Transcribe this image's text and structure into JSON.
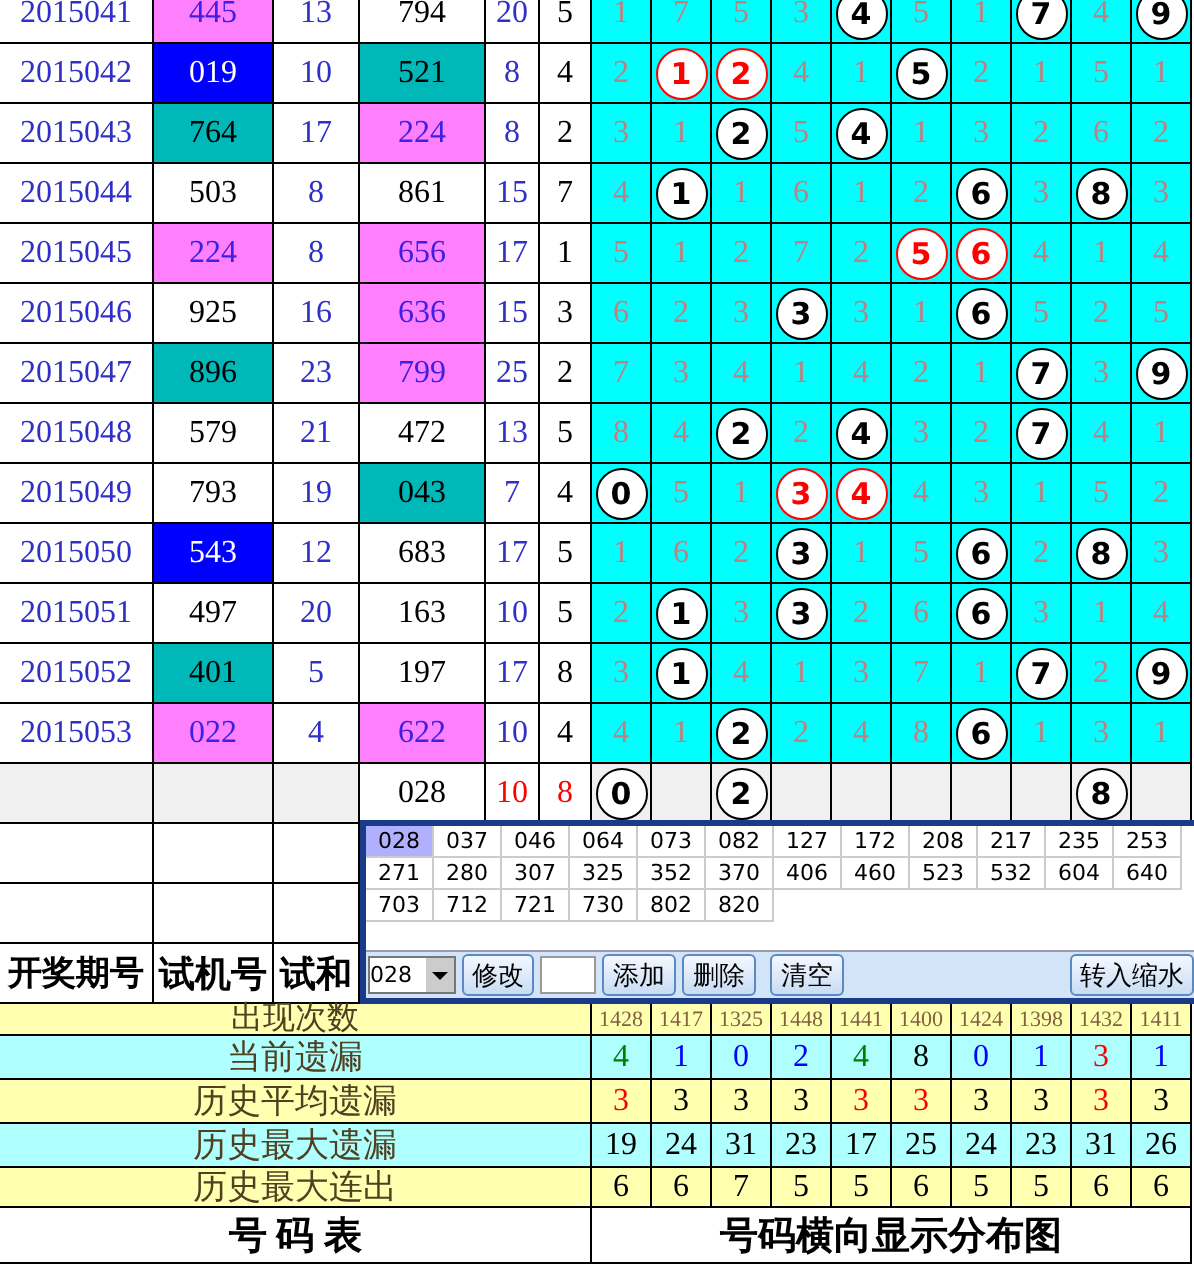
{
  "rows": [
    {
      "period": "2015041",
      "trial": {
        "text": "445",
        "color": "#ff80ff"
      },
      "trial_sum": "13",
      "number": {
        "text": "794",
        "color": "#ffffff"
      },
      "sum": "20",
      "span": "5",
      "cells": [
        {
          "text": "1",
          "kind": "miss"
        },
        {
          "text": "7",
          "kind": "miss"
        },
        {
          "text": "5",
          "kind": "miss"
        },
        {
          "text": "3",
          "kind": "miss"
        },
        {
          "text": "4",
          "kind": "ball"
        },
        {
          "text": "5",
          "kind": "miss"
        },
        {
          "text": "1",
          "kind": "miss"
        },
        {
          "text": "7",
          "kind": "ball"
        },
        {
          "text": "4",
          "kind": "miss"
        },
        {
          "text": "9",
          "kind": "ball"
        }
      ]
    },
    {
      "period": "2015042",
      "trial": {
        "text": "019",
        "color": "#0000ff"
      },
      "trial_sum": "10",
      "number": {
        "text": "521",
        "color": "#00b8b8"
      },
      "sum": "8",
      "span": "4",
      "cells": [
        {
          "text": "2",
          "kind": "miss"
        },
        {
          "text": "1",
          "kind": "red-ball"
        },
        {
          "text": "2",
          "kind": "red-ball"
        },
        {
          "text": "4",
          "kind": "miss"
        },
        {
          "text": "1",
          "kind": "miss"
        },
        {
          "text": "5",
          "kind": "ball"
        },
        {
          "text": "2",
          "kind": "miss"
        },
        {
          "text": "1",
          "kind": "miss"
        },
        {
          "text": "5",
          "kind": "miss"
        },
        {
          "text": "1",
          "kind": "miss"
        }
      ]
    },
    {
      "period": "2015043",
      "trial": {
        "text": "764",
        "color": "#00b8b8"
      },
      "trial_sum": "17",
      "number": {
        "text": "224",
        "color": "#ff80ff"
      },
      "sum": "8",
      "span": "2",
      "cells": [
        {
          "text": "3",
          "kind": "miss"
        },
        {
          "text": "1",
          "kind": "miss"
        },
        {
          "text": "2",
          "kind": "ball"
        },
        {
          "text": "5",
          "kind": "miss"
        },
        {
          "text": "4",
          "kind": "ball"
        },
        {
          "text": "1",
          "kind": "miss"
        },
        {
          "text": "3",
          "kind": "miss"
        },
        {
          "text": "2",
          "kind": "miss"
        },
        {
          "text": "6",
          "kind": "miss"
        },
        {
          "text": "2",
          "kind": "miss"
        }
      ]
    },
    {
      "period": "2015044",
      "trial": {
        "text": "503",
        "color": "#ffffff"
      },
      "trial_sum": "8",
      "number": {
        "text": "861",
        "color": "#ffffff"
      },
      "sum": "15",
      "span": "7",
      "cells": [
        {
          "text": "4",
          "kind": "miss"
        },
        {
          "text": "1",
          "kind": "ball"
        },
        {
          "text": "1",
          "kind": "miss"
        },
        {
          "text": "6",
          "kind": "miss"
        },
        {
          "text": "1",
          "kind": "miss"
        },
        {
          "text": "2",
          "kind": "miss"
        },
        {
          "text": "6",
          "kind": "ball"
        },
        {
          "text": "3",
          "kind": "miss"
        },
        {
          "text": "8",
          "kind": "ball"
        },
        {
          "text": "3",
          "kind": "miss"
        }
      ]
    },
    {
      "period": "2015045",
      "trial": {
        "text": "224",
        "color": "#ff80ff"
      },
      "trial_sum": "8",
      "number": {
        "text": "656",
        "color": "#ff80ff"
      },
      "sum": "17",
      "span": "1",
      "cells": [
        {
          "text": "5",
          "kind": "miss"
        },
        {
          "text": "1",
          "kind": "miss"
        },
        {
          "text": "2",
          "kind": "miss"
        },
        {
          "text": "7",
          "kind": "miss"
        },
        {
          "text": "2",
          "kind": "miss"
        },
        {
          "text": "5",
          "kind": "red-ball"
        },
        {
          "text": "6",
          "kind": "red-ball"
        },
        {
          "text": "4",
          "kind": "miss"
        },
        {
          "text": "1",
          "kind": "miss"
        },
        {
          "text": "4",
          "kind": "miss"
        }
      ]
    },
    {
      "period": "2015046",
      "trial": {
        "text": "925",
        "color": "#ffffff"
      },
      "trial_sum": "16",
      "number": {
        "text": "636",
        "color": "#ff80ff"
      },
      "sum": "15",
      "span": "3",
      "cells": [
        {
          "text": "6",
          "kind": "miss"
        },
        {
          "text": "2",
          "kind": "miss"
        },
        {
          "text": "3",
          "kind": "miss"
        },
        {
          "text": "3",
          "kind": "ball"
        },
        {
          "text": "3",
          "kind": "miss"
        },
        {
          "text": "1",
          "kind": "miss"
        },
        {
          "text": "6",
          "kind": "ball"
        },
        {
          "text": "5",
          "kind": "miss"
        },
        {
          "text": "2",
          "kind": "miss"
        },
        {
          "text": "5",
          "kind": "miss"
        }
      ]
    },
    {
      "period": "2015047",
      "trial": {
        "text": "896",
        "color": "#00b8b8"
      },
      "trial_sum": "23",
      "number": {
        "text": "799",
        "color": "#ff80ff"
      },
      "sum": "25",
      "span": "2",
      "cells": [
        {
          "text": "7",
          "kind": "miss"
        },
        {
          "text": "3",
          "kind": "miss"
        },
        {
          "text": "4",
          "kind": "miss"
        },
        {
          "text": "1",
          "kind": "miss"
        },
        {
          "text": "4",
          "kind": "miss"
        },
        {
          "text": "2",
          "kind": "miss"
        },
        {
          "text": "1",
          "kind": "miss"
        },
        {
          "text": "7",
          "kind": "ball"
        },
        {
          "text": "3",
          "kind": "miss"
        },
        {
          "text": "9",
          "kind": "ball"
        }
      ]
    },
    {
      "period": "2015048",
      "trial": {
        "text": "579",
        "color": "#ffffff"
      },
      "trial_sum": "21",
      "number": {
        "text": "472",
        "color": "#ffffff"
      },
      "sum": "13",
      "span": "5",
      "cells": [
        {
          "text": "8",
          "kind": "miss"
        },
        {
          "text": "4",
          "kind": "miss"
        },
        {
          "text": "2",
          "kind": "ball"
        },
        {
          "text": "2",
          "kind": "miss"
        },
        {
          "text": "4",
          "kind": "ball"
        },
        {
          "text": "3",
          "kind": "miss"
        },
        {
          "text": "2",
          "kind": "miss"
        },
        {
          "text": "7",
          "kind": "ball"
        },
        {
          "text": "4",
          "kind": "miss"
        },
        {
          "text": "1",
          "kind": "miss"
        }
      ]
    },
    {
      "period": "2015049",
      "trial": {
        "text": "793",
        "color": "#ffffff"
      },
      "trial_sum": "19",
      "number": {
        "text": "043",
        "color": "#00b8b8"
      },
      "sum": "7",
      "span": "4",
      "cells": [
        {
          "text": "0",
          "kind": "ball"
        },
        {
          "text": "5",
          "kind": "miss"
        },
        {
          "text": "1",
          "kind": "miss"
        },
        {
          "text": "3",
          "kind": "red-ball"
        },
        {
          "text": "4",
          "kind": "red-ball"
        },
        {
          "text": "4",
          "kind": "miss"
        },
        {
          "text": "3",
          "kind": "miss"
        },
        {
          "text": "1",
          "kind": "miss"
        },
        {
          "text": "5",
          "kind": "miss"
        },
        {
          "text": "2",
          "kind": "miss"
        }
      ]
    },
    {
      "period": "2015050",
      "trial": {
        "text": "543",
        "color": "#0000ff"
      },
      "trial_sum": "12",
      "number": {
        "text": "683",
        "color": "#ffffff"
      },
      "sum": "17",
      "span": "5",
      "cells": [
        {
          "text": "1",
          "kind": "miss"
        },
        {
          "text": "6",
          "kind": "miss"
        },
        {
          "text": "2",
          "kind": "miss"
        },
        {
          "text": "3",
          "kind": "ball"
        },
        {
          "text": "1",
          "kind": "miss"
        },
        {
          "text": "5",
          "kind": "miss"
        },
        {
          "text": "6",
          "kind": "ball"
        },
        {
          "text": "2",
          "kind": "miss"
        },
        {
          "text": "8",
          "kind": "ball"
        },
        {
          "text": "3",
          "kind": "miss"
        }
      ]
    },
    {
      "period": "2015051",
      "trial": {
        "text": "497",
        "color": "#ffffff"
      },
      "trial_sum": "20",
      "number": {
        "text": "163",
        "color": "#ffffff"
      },
      "sum": "10",
      "span": "5",
      "cells": [
        {
          "text": "2",
          "kind": "miss"
        },
        {
          "text": "1",
          "kind": "ball"
        },
        {
          "text": "3",
          "kind": "miss"
        },
        {
          "text": "3",
          "kind": "ball"
        },
        {
          "text": "2",
          "kind": "miss"
        },
        {
          "text": "6",
          "kind": "miss"
        },
        {
          "text": "6",
          "kind": "ball"
        },
        {
          "text": "3",
          "kind": "miss"
        },
        {
          "text": "1",
          "kind": "miss"
        },
        {
          "text": "4",
          "kind": "miss"
        }
      ]
    },
    {
      "period": "2015052",
      "trial": {
        "text": "401",
        "color": "#00b8b8"
      },
      "trial_sum": "5",
      "number": {
        "text": "197",
        "color": "#ffffff"
      },
      "sum": "17",
      "span": "8",
      "cells": [
        {
          "text": "3",
          "kind": "miss"
        },
        {
          "text": "1",
          "kind": "ball"
        },
        {
          "text": "4",
          "kind": "miss"
        },
        {
          "text": "1",
          "kind": "miss"
        },
        {
          "text": "3",
          "kind": "miss"
        },
        {
          "text": "7",
          "kind": "miss"
        },
        {
          "text": "1",
          "kind": "miss"
        },
        {
          "text": "7",
          "kind": "ball"
        },
        {
          "text": "2",
          "kind": "miss"
        },
        {
          "text": "9",
          "kind": "ball"
        }
      ]
    },
    {
      "period": "2015053",
      "trial": {
        "text": "022",
        "color": "#ff80ff"
      },
      "trial_sum": "4",
      "number": {
        "text": "622",
        "color": "#ff80ff"
      },
      "sum": "10",
      "span": "4",
      "cells": [
        {
          "text": "4",
          "kind": "miss"
        },
        {
          "text": "1",
          "kind": "miss"
        },
        {
          "text": "2",
          "kind": "ball"
        },
        {
          "text": "2",
          "kind": "miss"
        },
        {
          "text": "4",
          "kind": "miss"
        },
        {
          "text": "8",
          "kind": "miss"
        },
        {
          "text": "6",
          "kind": "ball"
        },
        {
          "text": "1",
          "kind": "miss"
        },
        {
          "text": "3",
          "kind": "miss"
        },
        {
          "text": "1",
          "kind": "miss"
        }
      ]
    }
  ],
  "prediction": {
    "number": "028",
    "sum": "10",
    "span": "8",
    "cells": [
      {
        "text": "0",
        "kind": "ball"
      },
      {
        "kind": "empty"
      },
      {
        "text": "2",
        "kind": "ball"
      },
      {
        "kind": "empty"
      },
      {
        "kind": "empty"
      },
      {
        "kind": "empty"
      },
      {
        "kind": "empty"
      },
      {
        "kind": "empty"
      },
      {
        "text": "8",
        "kind": "ball"
      },
      {
        "kind": "empty"
      }
    ]
  },
  "header": [
    "开奖期号",
    "试机号",
    "试和"
  ],
  "stats": [
    {
      "label": "出现次数",
      "kind": "count",
      "values": [
        {
          "text": "1428",
          "color": "#806040"
        },
        {
          "text": "1417",
          "color": "#806040"
        },
        {
          "text": "1325",
          "color": "#806040"
        },
        {
          "text": "1448",
          "color": "#806040"
        },
        {
          "text": "1441",
          "color": "#806040"
        },
        {
          "text": "1400",
          "color": "#806040"
        },
        {
          "text": "1424",
          "color": "#806040"
        },
        {
          "text": "1398",
          "color": "#806040"
        },
        {
          "text": "1432",
          "color": "#806040"
        },
        {
          "text": "1411",
          "color": "#806040"
        }
      ]
    },
    {
      "label": "当前遗漏",
      "kind": "cyan",
      "values": [
        {
          "text": "4",
          "color": "#008000"
        },
        {
          "text": "1",
          "color": "#0000ff"
        },
        {
          "text": "0",
          "color": "#0000ff"
        },
        {
          "text": "2",
          "color": "#0000ff"
        },
        {
          "text": "4",
          "color": "#008000"
        },
        {
          "text": "8",
          "color": "#000000"
        },
        {
          "text": "0",
          "color": "#0000ff"
        },
        {
          "text": "1",
          "color": "#0000ff"
        },
        {
          "text": "3",
          "color": "#ff0000"
        },
        {
          "text": "1",
          "color": "#0000ff"
        }
      ]
    },
    {
      "label": "历史平均遗漏",
      "kind": "yellow",
      "values": [
        {
          "text": "3",
          "color": "#ff0000"
        },
        {
          "text": "3",
          "color": "#000000"
        },
        {
          "text": "3",
          "color": "#000000"
        },
        {
          "text": "3",
          "color": "#000000"
        },
        {
          "text": "3",
          "color": "#ff0000"
        },
        {
          "text": "3",
          "color": "#ff0000"
        },
        {
          "text": "3",
          "color": "#000000"
        },
        {
          "text": "3",
          "color": "#000000"
        },
        {
          "text": "3",
          "color": "#ff0000"
        },
        {
          "text": "3",
          "color": "#000000"
        }
      ]
    },
    {
      "label": "历史最大遗漏",
      "kind": "cyan",
      "values": [
        {
          "text": "19",
          "color": "#000000"
        },
        {
          "text": "24",
          "color": "#000000"
        },
        {
          "text": "31",
          "color": "#000000"
        },
        {
          "text": "23",
          "color": "#000000"
        },
        {
          "text": "17",
          "color": "#000000"
        },
        {
          "text": "25",
          "color": "#000000"
        },
        {
          "text": "24",
          "color": "#000000"
        },
        {
          "text": "23",
          "color": "#000000"
        },
        {
          "text": "31",
          "color": "#000000"
        },
        {
          "text": "26",
          "color": "#000000"
        }
      ]
    },
    {
      "label": "历史最大连出",
      "kind": "yellow",
      "values": [
        {
          "text": "6",
          "color": "#000000"
        },
        {
          "text": "6",
          "color": "#000000"
        },
        {
          "text": "7",
          "color": "#000000"
        },
        {
          "text": "5",
          "color": "#000000"
        },
        {
          "text": "5",
          "color": "#000000"
        },
        {
          "text": "6",
          "color": "#000000"
        },
        {
          "text": "5",
          "color": "#000000"
        },
        {
          "text": "5",
          "color": "#000000"
        },
        {
          "text": "6",
          "color": "#000000"
        },
        {
          "text": "6",
          "color": "#000000"
        }
      ]
    }
  ],
  "footer": {
    "left": "号 码 表",
    "right": "号码横向显示分布图"
  },
  "popup": {
    "numbers": [
      {
        "text": "028",
        "selected": true
      },
      {
        "text": "037",
        "selected": false
      },
      {
        "text": "046",
        "selected": false
      },
      {
        "text": "064",
        "selected": false
      },
      {
        "text": "073",
        "selected": false
      },
      {
        "text": "082",
        "selected": false
      },
      {
        "text": "127",
        "selected": false
      },
      {
        "text": "172",
        "selected": false
      },
      {
        "text": "208",
        "selected": false
      },
      {
        "text": "217",
        "selected": false
      },
      {
        "text": "235",
        "selected": false
      },
      {
        "text": "253",
        "selected": false
      },
      {
        "text": "271",
        "selected": false
      },
      {
        "text": "280",
        "selected": false
      },
      {
        "text": "307",
        "selected": false
      },
      {
        "text": "325",
        "selected": false
      },
      {
        "text": "352",
        "selected": false
      },
      {
        "text": "370",
        "selected": false
      },
      {
        "text": "406",
        "selected": false
      },
      {
        "text": "460",
        "selected": false
      },
      {
        "text": "523",
        "selected": false
      },
      {
        "text": "532",
        "selected": false
      },
      {
        "text": "604",
        "selected": false
      },
      {
        "text": "640",
        "selected": false
      },
      {
        "text": "703",
        "selected": false
      },
      {
        "text": "712",
        "selected": false
      },
      {
        "text": "721",
        "selected": false
      },
      {
        "text": "730",
        "selected": false
      },
      {
        "text": "802",
        "selected": false
      },
      {
        "text": "820",
        "selected": false
      }
    ],
    "dropdown": "028",
    "buttons": [
      "修改",
      "添加",
      "删除",
      "清空"
    ],
    "transfer_button": "转入缩水"
  }
}
